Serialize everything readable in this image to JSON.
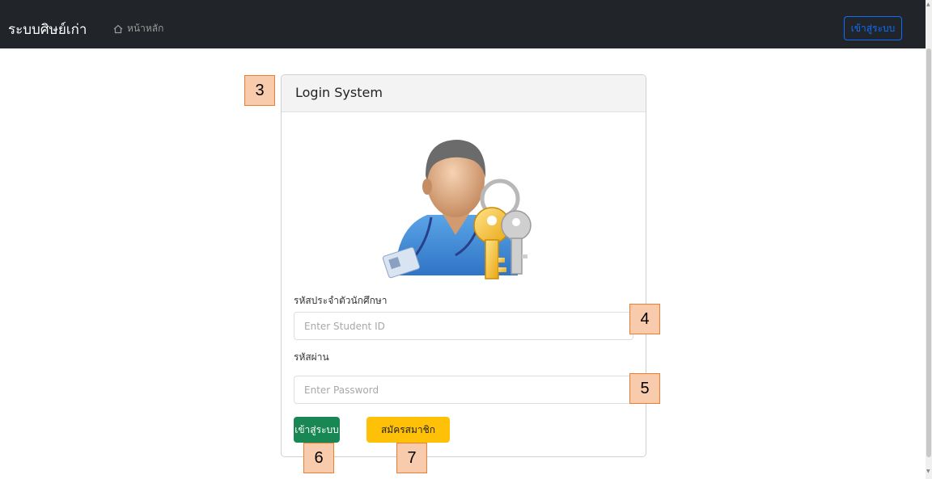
{
  "navbar": {
    "brand": "ระบบศิษย์เก่า",
    "home_link": "หน้าหลัก",
    "login_button": "เข้าสู่ระบบ"
  },
  "card": {
    "title": "Login System",
    "student_id_label": "รหัสประจำตัวนักศึกษา",
    "student_id_placeholder": "Enter Student ID",
    "password_label": "รหัสผ่าน",
    "password_placeholder": "Enter Password",
    "login_button": "เข้าสู่ระบบ",
    "register_button": "สมัครสมาชิก"
  },
  "callouts": [
    "3",
    "4",
    "5",
    "6",
    "7"
  ],
  "colors": {
    "navbar_bg": "#212529",
    "primary": "#0d6efd",
    "success": "#198754",
    "warning": "#ffc107",
    "callout_fill": "#f8cbad",
    "callout_border": "#ed7d31"
  }
}
